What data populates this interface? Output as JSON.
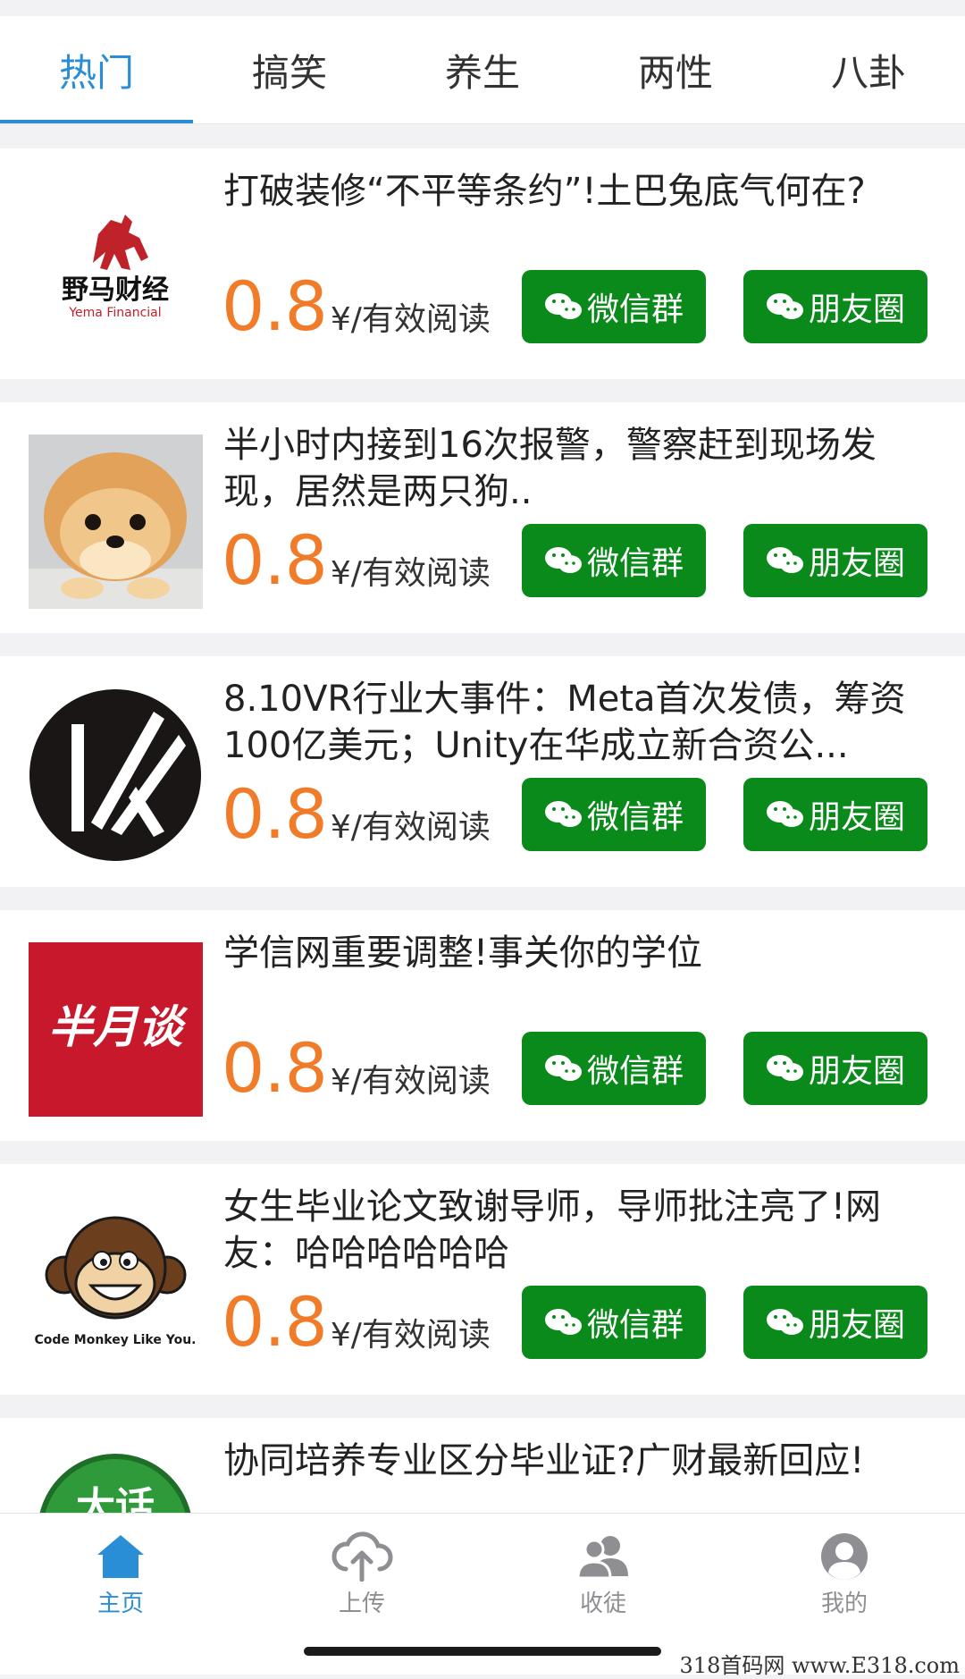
{
  "tabs": [
    "热门",
    "搞笑",
    "养生",
    "两性",
    "八卦"
  ],
  "active_tab": "热门",
  "articles": [
    {
      "title": "打破装修“不平等条约”!土巴兔底气何在?",
      "thumb": "yema-financial-logo",
      "logo_text": "野马财经",
      "logo_sub": "Yema Financial"
    },
    {
      "title": "半小时内接到16次报警，警察赶到现场发现，居然是两只狗..",
      "thumb": "pomeranian-dog-photo"
    },
    {
      "title": "8.10VR行业大事件：Meta首次发债，筹资100亿美元；Unity在华成立新合资公...",
      "thumb": "vk-circle-logo"
    },
    {
      "title": "学信网重要调整!事关你的学位",
      "thumb": "banyuetan-logo",
      "logo_text": "半月谈"
    },
    {
      "title": "女生毕业论文致谢导师，导师批注亮了!网友：哈哈哈哈哈哈",
      "thumb": "code-monkey-logo",
      "logo_text": "Code Monkey Like You."
    },
    {
      "title": "协同培养专业区分毕业证?广财最新回应!",
      "thumb": "green-circle-logo",
      "logo_text": "大话"
    }
  ],
  "price": {
    "value": "0.8",
    "unit": "¥/有效阅读"
  },
  "buttons": {
    "wechat_group": "微信群",
    "moments": "朋友圈"
  },
  "bottom_nav": [
    {
      "label": "主页",
      "icon": "home-icon",
      "active": true
    },
    {
      "label": "上传",
      "icon": "cloud-upload-icon",
      "active": false
    },
    {
      "label": "收徒",
      "icon": "users-icon",
      "active": false
    },
    {
      "label": "我的",
      "icon": "user-icon",
      "active": false
    }
  ],
  "watermark": "318首码网 www.E318.com",
  "colors": {
    "accent": "#2a8ed6",
    "price": "#f07c2a",
    "button": "#0b8a1c"
  }
}
